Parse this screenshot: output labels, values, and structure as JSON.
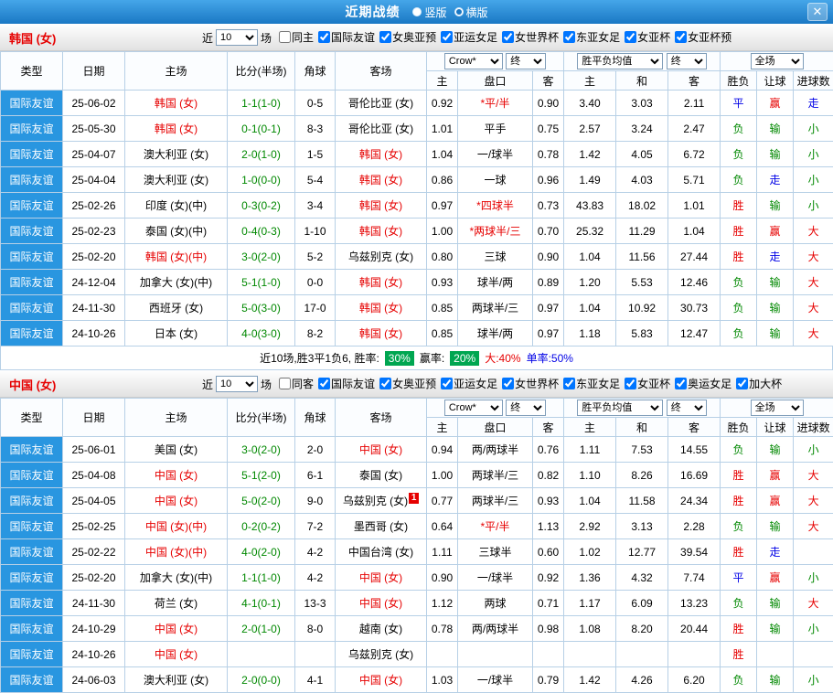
{
  "colors": {
    "red": "#e60000",
    "green": "#008800",
    "blue": "#0000e6",
    "type_cell_bg": "#2996e0",
    "badge_green": "#00a651",
    "border": "#b7d0e6",
    "titlebar_top": "#45a6e9",
    "titlebar_bottom": "#1a78c4"
  },
  "outcome_color_map": {
    "胜": "red",
    "赢": "red",
    "大": "red",
    "负": "green",
    "输": "green",
    "小": "green",
    "平": "blue",
    "走": "blue"
  },
  "header": {
    "title": "近期战绩",
    "layout_vertical": "竖版",
    "layout_horizontal": "横版",
    "close_label": "✕"
  },
  "filter_common": {
    "near": "近",
    "count": "10",
    "games": "场"
  },
  "table_headers": {
    "type": "类型",
    "date": "日期",
    "home": "主场",
    "score": "比分(半场)",
    "corner": "角球",
    "away": "客场",
    "odds_company_select": "Crow*",
    "odds_final_select": "终",
    "col_home": "主",
    "col_handicap": "盘口",
    "col_away": "客",
    "avg_select": "胜平负均值",
    "avg_final_select": "终",
    "avg_home": "主",
    "avg_draw": "和",
    "avg_away": "客",
    "fulltime_select": "全场",
    "col_result": "胜负",
    "col_let": "让球",
    "col_goals": "进球数"
  },
  "sections": [
    {
      "team_title": "韩国 (女)",
      "filter_checkboxes": [
        {
          "label": "同主",
          "checked": false
        },
        {
          "label": "国际友谊",
          "checked": true
        },
        {
          "label": "女奥亚预",
          "checked": true
        },
        {
          "label": "亚运女足",
          "checked": true
        },
        {
          "label": "女世界杯",
          "checked": true
        },
        {
          "label": "东亚女足",
          "checked": true
        },
        {
          "label": "女亚杯",
          "checked": true
        },
        {
          "label": "女亚杯预",
          "checked": true
        }
      ],
      "rows": [
        {
          "type": "国际友谊",
          "date": "25-06-02",
          "home": "韩国 (女)",
          "home_red": true,
          "score": "1-1(1-0)",
          "corner": "0-5",
          "away": "哥伦比亚 (女)",
          "away_red": false,
          "odds_home": "0.92",
          "handicap": "*平/半",
          "odds_away": "0.90",
          "avg_home": "3.40",
          "avg_draw": "3.03",
          "avg_away": "2.11",
          "result": "平",
          "let": "赢",
          "goal": "走"
        },
        {
          "type": "国际友谊",
          "date": "25-05-30",
          "home": "韩国 (女)",
          "home_red": true,
          "score": "0-1(0-1)",
          "corner": "8-3",
          "away": "哥伦比亚 (女)",
          "away_red": false,
          "odds_home": "1.01",
          "handicap": "平手",
          "odds_away": "0.75",
          "avg_home": "2.57",
          "avg_draw": "3.24",
          "avg_away": "2.47",
          "result": "负",
          "let": "输",
          "goal": "小"
        },
        {
          "type": "国际友谊",
          "date": "25-04-07",
          "home": "澳大利亚 (女)",
          "home_red": false,
          "score": "2-0(1-0)",
          "corner": "1-5",
          "away": "韩国 (女)",
          "away_red": true,
          "odds_home": "1.04",
          "handicap": "一/球半",
          "odds_away": "0.78",
          "avg_home": "1.42",
          "avg_draw": "4.05",
          "avg_away": "6.72",
          "result": "负",
          "let": "输",
          "goal": "小"
        },
        {
          "type": "国际友谊",
          "date": "25-04-04",
          "home": "澳大利亚 (女)",
          "home_red": false,
          "score": "1-0(0-0)",
          "corner": "5-4",
          "away": "韩国 (女)",
          "away_red": true,
          "odds_home": "0.86",
          "handicap": "一球",
          "odds_away": "0.96",
          "avg_home": "1.49",
          "avg_draw": "4.03",
          "avg_away": "5.71",
          "result": "负",
          "let": "走",
          "goal": "小"
        },
        {
          "type": "国际友谊",
          "date": "25-02-26",
          "home": "印度 (女)(中)",
          "home_red": false,
          "score": "0-3(0-2)",
          "corner": "3-4",
          "away": "韩国 (女)",
          "away_red": true,
          "odds_home": "0.97",
          "handicap": "*四球半",
          "odds_away": "0.73",
          "avg_home": "43.83",
          "avg_draw": "18.02",
          "avg_away": "1.01",
          "result": "胜",
          "let": "输",
          "goal": "小"
        },
        {
          "type": "国际友谊",
          "date": "25-02-23",
          "home": "泰国 (女)(中)",
          "home_red": false,
          "score": "0-4(0-3)",
          "corner": "1-10",
          "away": "韩国 (女)",
          "away_red": true,
          "odds_home": "1.00",
          "handicap": "*两球半/三",
          "odds_away": "0.70",
          "avg_home": "25.32",
          "avg_draw": "11.29",
          "avg_away": "1.04",
          "result": "胜",
          "let": "赢",
          "goal": "大"
        },
        {
          "type": "国际友谊",
          "date": "25-02-20",
          "home": "韩国 (女)(中)",
          "home_red": true,
          "score": "3-0(2-0)",
          "corner": "5-2",
          "away": "乌兹别克 (女)",
          "away_red": false,
          "odds_home": "0.80",
          "handicap": "三球",
          "odds_away": "0.90",
          "avg_home": "1.04",
          "avg_draw": "11.56",
          "avg_away": "27.44",
          "result": "胜",
          "let": "走",
          "goal": "大"
        },
        {
          "type": "国际友谊",
          "date": "24-12-04",
          "home": "加拿大 (女)(中)",
          "home_red": false,
          "score": "5-1(1-0)",
          "corner": "0-0",
          "away": "韩国 (女)",
          "away_red": true,
          "odds_home": "0.93",
          "handicap": "球半/两",
          "odds_away": "0.89",
          "avg_home": "1.20",
          "avg_draw": "5.53",
          "avg_away": "12.46",
          "result": "负",
          "let": "输",
          "goal": "大"
        },
        {
          "type": "国际友谊",
          "date": "24-11-30",
          "home": "西班牙 (女)",
          "home_red": false,
          "score": "5-0(3-0)",
          "corner": "17-0",
          "away": "韩国 (女)",
          "away_red": true,
          "odds_home": "0.85",
          "handicap": "两球半/三",
          "odds_away": "0.97",
          "avg_home": "1.04",
          "avg_draw": "10.92",
          "avg_away": "30.73",
          "result": "负",
          "let": "输",
          "goal": "大"
        },
        {
          "type": "国际友谊",
          "date": "24-10-26",
          "home": "日本 (女)",
          "home_red": false,
          "score": "4-0(3-0)",
          "corner": "8-2",
          "away": "韩国 (女)",
          "away_red": true,
          "odds_home": "0.85",
          "handicap": "球半/两",
          "odds_away": "0.97",
          "avg_home": "1.18",
          "avg_draw": "5.83",
          "avg_away": "12.47",
          "result": "负",
          "let": "输",
          "goal": "大"
        }
      ],
      "summary": {
        "prefix": "近10场,胜3平1负6, 胜率:",
        "win_rate": "30%",
        "win_label": "赢率:",
        "odds_rate": "20%",
        "big_text": "大:40%",
        "single_text": "单率:50%"
      }
    },
    {
      "team_title": "中国 (女)",
      "filter_checkboxes": [
        {
          "label": "同客",
          "checked": false
        },
        {
          "label": "国际友谊",
          "checked": true
        },
        {
          "label": "女奥亚预",
          "checked": true
        },
        {
          "label": "亚运女足",
          "checked": true
        },
        {
          "label": "女世界杯",
          "checked": true
        },
        {
          "label": "东亚女足",
          "checked": true
        },
        {
          "label": "女亚杯",
          "checked": true
        },
        {
          "label": "奥运女足",
          "checked": true
        },
        {
          "label": "加大杯",
          "checked": true
        }
      ],
      "rows": [
        {
          "type": "国际友谊",
          "date": "25-06-01",
          "home": "美国 (女)",
          "home_red": false,
          "score": "3-0(2-0)",
          "corner": "2-0",
          "away": "中国 (女)",
          "away_red": true,
          "odds_home": "0.94",
          "handicap": "两/两球半",
          "odds_away": "0.76",
          "avg_home": "1.11",
          "avg_draw": "7.53",
          "avg_away": "14.55",
          "result": "负",
          "let": "输",
          "goal": "小"
        },
        {
          "type": "国际友谊",
          "date": "25-04-08",
          "home": "中国 (女)",
          "home_red": true,
          "score": "5-1(2-0)",
          "corner": "6-1",
          "away": "泰国 (女)",
          "away_red": false,
          "odds_home": "1.00",
          "handicap": "两球半/三",
          "odds_away": "0.82",
          "avg_home": "1.10",
          "avg_draw": "8.26",
          "avg_away": "16.69",
          "result": "胜",
          "let": "赢",
          "goal": "大"
        },
        {
          "type": "国际友谊",
          "date": "25-04-05",
          "home": "中国 (女)",
          "home_red": true,
          "score": "5-0(2-0)",
          "corner": "9-0",
          "away": "乌兹别克 (女)",
          "away_red": false,
          "away_redcard": "1",
          "odds_home": "0.77",
          "handicap": "两球半/三",
          "odds_away": "0.93",
          "avg_home": "1.04",
          "avg_draw": "11.58",
          "avg_away": "24.34",
          "result": "胜",
          "let": "赢",
          "goal": "大"
        },
        {
          "type": "国际友谊",
          "date": "25-02-25",
          "home": "中国 (女)(中)",
          "home_red": true,
          "score": "0-2(0-2)",
          "corner": "7-2",
          "away": "墨西哥 (女)",
          "away_red": false,
          "odds_home": "0.64",
          "handicap": "*平/半",
          "odds_away": "1.13",
          "avg_home": "2.92",
          "avg_draw": "3.13",
          "avg_away": "2.28",
          "result": "负",
          "let": "输",
          "goal": "大"
        },
        {
          "type": "国际友谊",
          "date": "25-02-22",
          "home": "中国 (女)(中)",
          "home_red": true,
          "score": "4-0(2-0)",
          "corner": "4-2",
          "away": "中国台湾 (女)",
          "away_red": false,
          "odds_home": "1.11",
          "handicap": "三球半",
          "odds_away": "0.60",
          "avg_home": "1.02",
          "avg_draw": "12.77",
          "avg_away": "39.54",
          "result": "胜",
          "let": "走",
          "goal": ""
        },
        {
          "type": "国际友谊",
          "date": "25-02-20",
          "home": "加拿大 (女)(中)",
          "home_red": false,
          "score": "1-1(1-0)",
          "corner": "4-2",
          "away": "中国 (女)",
          "away_red": true,
          "odds_home": "0.90",
          "handicap": "一/球半",
          "odds_away": "0.92",
          "avg_home": "1.36",
          "avg_draw": "4.32",
          "avg_away": "7.74",
          "result": "平",
          "let": "赢",
          "goal": "小"
        },
        {
          "type": "国际友谊",
          "date": "24-11-30",
          "home": "荷兰 (女)",
          "home_red": false,
          "score": "4-1(0-1)",
          "corner": "13-3",
          "away": "中国 (女)",
          "away_red": true,
          "odds_home": "1.12",
          "handicap": "两球",
          "odds_away": "0.71",
          "avg_home": "1.17",
          "avg_draw": "6.09",
          "avg_away": "13.23",
          "result": "负",
          "let": "输",
          "goal": "大"
        },
        {
          "type": "国际友谊",
          "date": "24-10-29",
          "home": "中国 (女)",
          "home_red": true,
          "score": "2-0(1-0)",
          "corner": "8-0",
          "away": "越南 (女)",
          "away_red": false,
          "odds_home": "0.78",
          "handicap": "两/两球半",
          "odds_away": "0.98",
          "avg_home": "1.08",
          "avg_draw": "8.20",
          "avg_away": "20.44",
          "result": "胜",
          "let": "输",
          "goal": "小"
        },
        {
          "type": "国际友谊",
          "date": "24-10-26",
          "home": "中国 (女)",
          "home_red": true,
          "score": "",
          "corner": "",
          "away": "乌兹别克 (女)",
          "away_red": false,
          "odds_home": "",
          "handicap": "",
          "odds_away": "",
          "avg_home": "",
          "avg_draw": "",
          "avg_away": "",
          "result": "胜",
          "let": "",
          "goal": ""
        },
        {
          "type": "国际友谊",
          "date": "24-06-03",
          "home": "澳大利亚 (女)",
          "home_red": false,
          "score": "2-0(0-0)",
          "corner": "4-1",
          "away": "中国 (女)",
          "away_red": true,
          "odds_home": "1.03",
          "handicap": "一/球半",
          "odds_away": "0.79",
          "avg_home": "1.42",
          "avg_draw": "4.26",
          "avg_away": "6.20",
          "result": "负",
          "let": "输",
          "goal": "小"
        }
      ]
    }
  ]
}
